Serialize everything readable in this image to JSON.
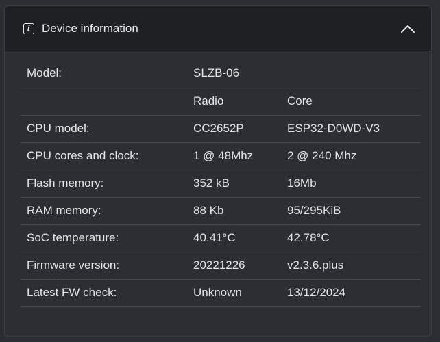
{
  "header": {
    "title": "Device information",
    "info_icon": "info-icon",
    "toggle_icon": "chevron-up-icon"
  },
  "model": {
    "label": "Model:",
    "value": "SLZB-06"
  },
  "columns": {
    "radio": "Radio",
    "core": "Core"
  },
  "rows": [
    {
      "label": "CPU model:",
      "radio": "CC2652P",
      "core": "ESP32-D0WD-V3"
    },
    {
      "label": "CPU cores and clock:",
      "radio": "1 @ 48Mhz",
      "core": "2 @ 240 Mhz"
    },
    {
      "label": "Flash memory:",
      "radio": "352 kB",
      "core": "16Mb"
    },
    {
      "label": "RAM memory:",
      "radio": "88 Kb",
      "core": "95/295KiB"
    },
    {
      "label": "SoC temperature:",
      "radio": "40.41°C",
      "core": "42.78°C"
    },
    {
      "label": "Firmware version:",
      "radio": "20221226",
      "core": "v2.3.6.plus"
    },
    {
      "label": "Latest FW check:",
      "radio": "Unknown",
      "core": "13/12/2024"
    }
  ]
}
